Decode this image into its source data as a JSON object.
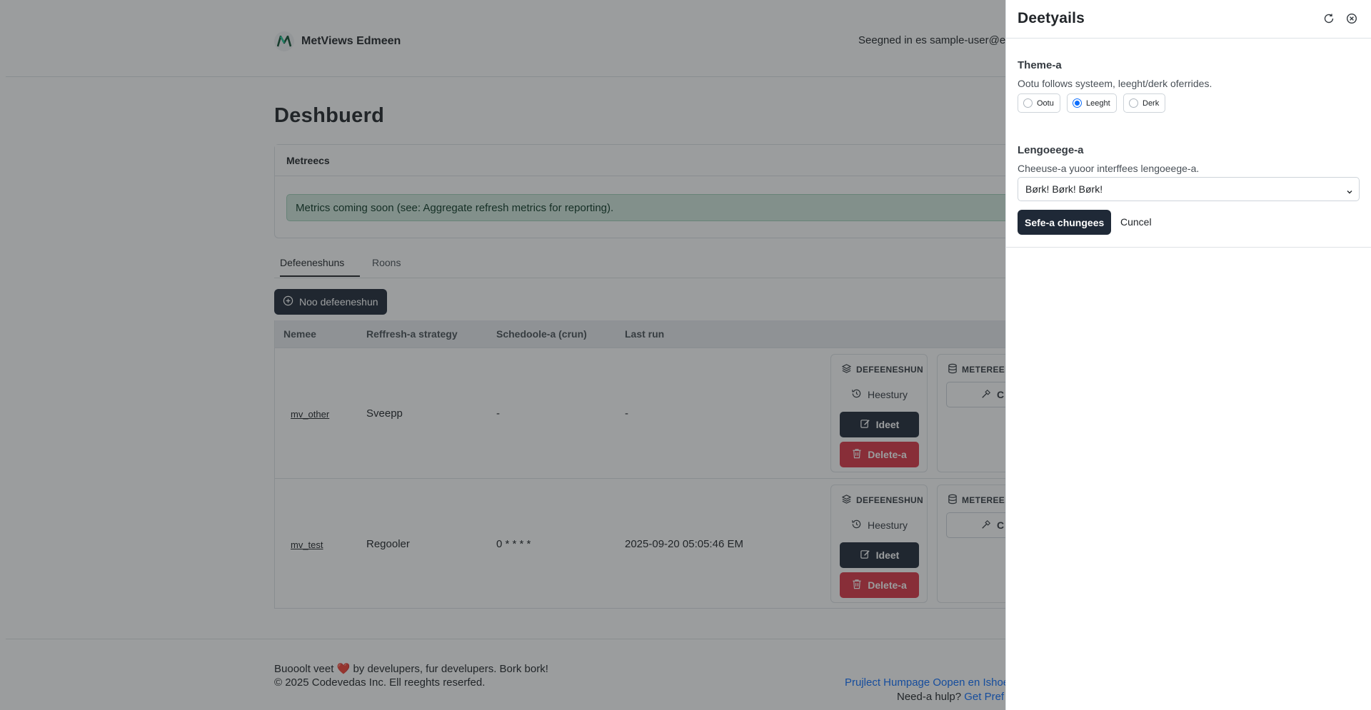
{
  "app": {
    "brand_name": "MetViews Edmeen",
    "signed_in_text": "Seegned in es sample-user@e"
  },
  "dashboard": {
    "title": "Deshbuerd",
    "metrics_card": {
      "header": "Metreecs",
      "alert": "Metrics coming soon (see: Aggregate refresh metrics for reporting)."
    },
    "tabs": [
      {
        "label": "Defeeneshuns",
        "active": true
      },
      {
        "label": "Roons",
        "active": false
      }
    ],
    "new_button_label": "Noo defeeneshun",
    "table": {
      "columns": [
        "Nemee",
        "Reffresh-a strategy",
        "Schedoole-a (crun)",
        "Last run"
      ],
      "rows": [
        {
          "name": "mv_other",
          "strategy": "Sveepp",
          "schedule": "-",
          "last_run": "-"
        },
        {
          "name": "mv_test",
          "strategy": "Regooler",
          "schedule": "0 * * * *",
          "last_run": "2025-09-20 05:05:46 EM"
        }
      ],
      "actions": {
        "definition_title": "DEFEENESHUN",
        "history_label": "Heestury",
        "edit_label": "Ideet",
        "delete_label": "Delete-a",
        "metrics_title": "METEREEE",
        "metrics_button_label": "C"
      }
    }
  },
  "footer": {
    "line1_prefix": "Buooolt veet",
    "heart": "❤️",
    "line1_suffix": "by develupers, fur develupers. Bork bork!",
    "line2": "© 2025 Codevedas Inc. Ell reeghts reserfed.",
    "project_link": "Prujlect Humpage Oopen en Ishoe",
    "help_prefix": "Need-a hulp?",
    "help_link": "Get Pref"
  },
  "details_panel": {
    "title": "Deetyails",
    "theme": {
      "title": "Theme-a",
      "help": "Ootu follows systeem, leeght/derk oferrides.",
      "options": [
        "Ootu",
        "Leeght",
        "Derk"
      ],
      "selected": "Leeght"
    },
    "language": {
      "title": "Lengoeege-a",
      "help": "Cheeuse-a yuoor interffees lengoeege-a.",
      "selected": "Børk! Børk! Børk!"
    },
    "save_label": "Sefe-a chungees",
    "cancel_label": "Cuncel"
  },
  "colors": {
    "primary_dark": "#1f2937",
    "danger": "#dc3545",
    "link": "#0d6efd",
    "alert_bg": "#d1e7dd",
    "radio_selected": "#0d6efd"
  }
}
